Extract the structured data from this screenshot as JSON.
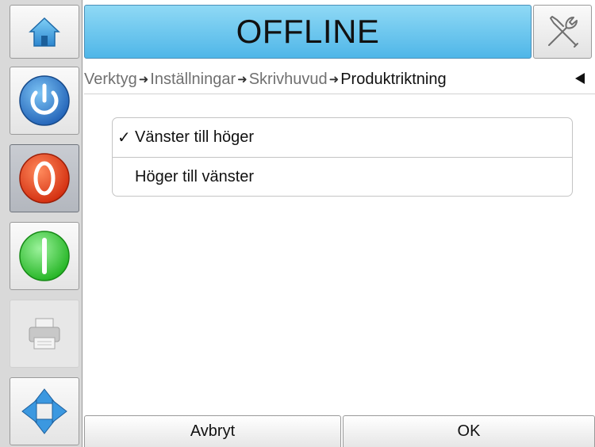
{
  "header": {
    "status": "OFFLINE",
    "status_color": "#5bbdea",
    "home_icon": "home-icon",
    "tools_icon": "wrench-screwdriver-icon"
  },
  "sidebar": {
    "items": [
      {
        "name": "power",
        "icon": "power-icon",
        "color": "#2a78c8"
      },
      {
        "name": "stop",
        "icon": "stop-icon",
        "color": "#e2451d"
      },
      {
        "name": "start",
        "icon": "start-icon",
        "color": "#33cc33"
      },
      {
        "name": "print",
        "icon": "printer-icon"
      },
      {
        "name": "navigate",
        "icon": "navigation-arrows-icon",
        "color": "#3b98e0"
      }
    ]
  },
  "breadcrumb": {
    "items": [
      "Verktyg",
      "Inställningar",
      "Skrivhuvud",
      "Produktriktning"
    ],
    "separator": "➜"
  },
  "options": [
    {
      "label": "Vänster till höger",
      "selected": true,
      "check": "✓"
    },
    {
      "label": "Höger till vänster",
      "selected": false
    }
  ],
  "footer": {
    "cancel": "Avbryt",
    "ok": "OK"
  }
}
